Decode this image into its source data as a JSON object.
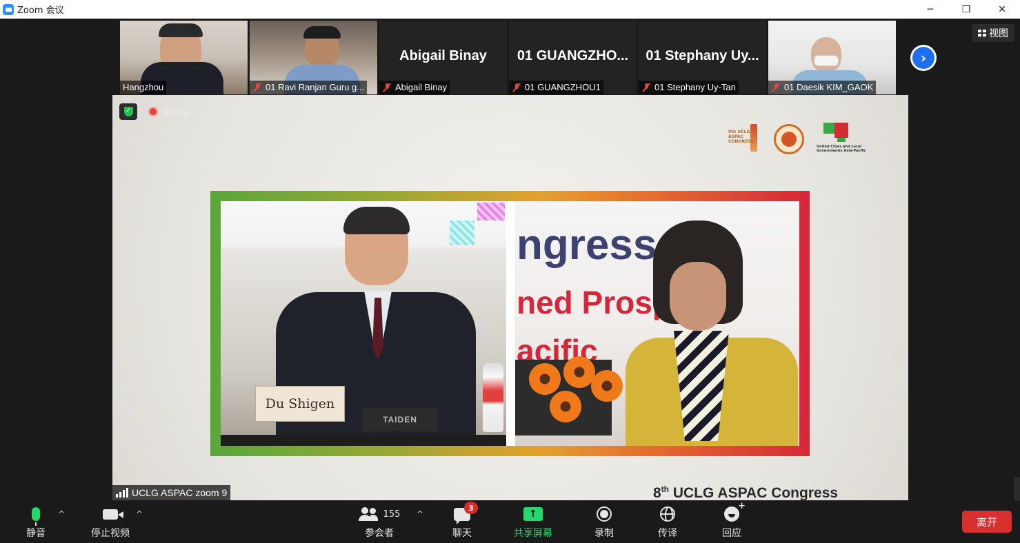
{
  "window": {
    "title": "Zoom 会议",
    "controls": [
      "─",
      "❐",
      "✕"
    ]
  },
  "header": {
    "view_label": "视图"
  },
  "participants": [
    {
      "name": "Hangzhou",
      "muted": false,
      "display": "video"
    },
    {
      "name": "01 Ravi Ranjan Guru g...",
      "muted": true,
      "display": "video"
    },
    {
      "name": "Abigail Binay",
      "muted": true,
      "display": "name",
      "big_name": "Abigail Binay"
    },
    {
      "name": "01 GUANGZHOU1",
      "muted": true,
      "display": "name",
      "big_name": "01  GUANGZHO..."
    },
    {
      "name": "01 Stephany Uy-Tan",
      "muted": true,
      "display": "name",
      "big_name": "01  Stephany Uy..."
    },
    {
      "name": "01 Daesik KIM_GAOK",
      "muted": true,
      "display": "video"
    }
  ],
  "stage": {
    "recording_text": "录制中",
    "speaker_label": "UCLG ASPAC zoom 9",
    "nameplate": "Du Shigen",
    "desk_brand": "TAIDEN",
    "slide_words": [
      "ngress",
      "ned Prosp",
      "acific"
    ],
    "congress_title_prefix": "8",
    "congress_title_sup": "th",
    "congress_title": "UCLG ASPAC Congress",
    "logo1_text": "8th UCLG ASPAC CONGRESS",
    "logo3_text": "United Cities and Local Governments Asia-Pacific"
  },
  "toolbar": {
    "mute_label": "静音",
    "video_label": "停止视频",
    "participants_label": "参会者",
    "participants_count": "155",
    "chat_label": "聊天",
    "chat_badge": "3",
    "share_label": "共享屏幕",
    "record_label": "录制",
    "interpret_label": "传译",
    "reaction_label": "回应",
    "leave_label": "离开"
  },
  "colors": {
    "accent_green": "#23d96b",
    "leave_red": "#d8302f",
    "next_blue": "#1f6ff2"
  }
}
